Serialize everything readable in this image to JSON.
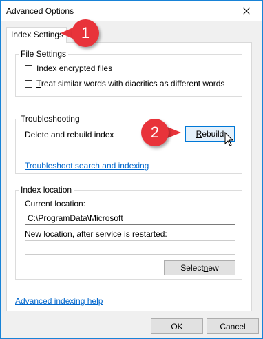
{
  "window": {
    "title": "Advanced Options",
    "accent_color": "#1883d7"
  },
  "tabs": [
    {
      "label": "Index Settings",
      "selected": true
    }
  ],
  "file_settings": {
    "legend": "File Settings",
    "checkboxes": [
      {
        "label": "Index encrypted files",
        "checked": false
      },
      {
        "label": "Treat similar words with diacritics as different words",
        "checked": false
      }
    ]
  },
  "troubleshooting": {
    "legend": "Troubleshooting",
    "description": "Delete and rebuild index",
    "rebuild_button": "Rebuild",
    "troubleshoot_link": "Troubleshoot search and indexing"
  },
  "index_location": {
    "legend": "Index location",
    "current_label": "Current location:",
    "current_value": "C:\\ProgramData\\Microsoft",
    "new_label": "New location, after service is restarted:",
    "new_value": "",
    "select_new_button": "Select new"
  },
  "advanced_help_link": "Advanced indexing help",
  "footer": {
    "ok_button": "OK",
    "cancel_button": "Cancel"
  },
  "annotations": {
    "callout_1": "1",
    "callout_2": "2",
    "callout_color": "#e8333a"
  }
}
